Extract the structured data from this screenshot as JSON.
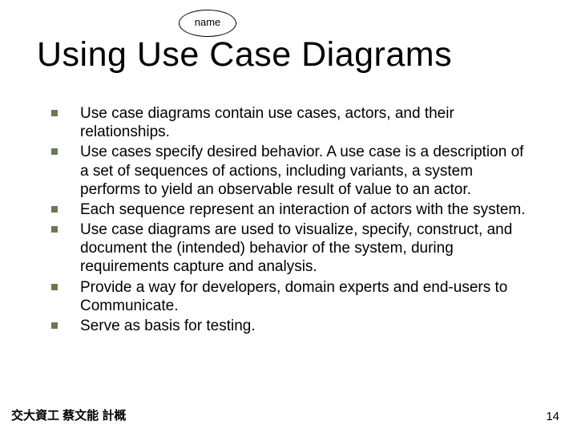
{
  "callout": {
    "label": "name"
  },
  "title": "Using Use Case Diagrams",
  "bullets": [
    "Use case diagrams contain use cases, actors, and their relationships.",
    "Use cases specify desired behavior. A use case is a description of a set of sequences of actions, including variants, a system performs to yield an observable result of value to an actor.",
    "Each sequence represent an interaction of actors with the system.",
    "Use case diagrams are used to visualize, specify, construct, and document the (intended) behavior of the system, during requirements capture and analysis.",
    "Provide a way for developers, domain experts and end-users to Communicate.",
    "Serve as basis for testing."
  ],
  "footer": {
    "left": "交大資工 蔡文能 計概",
    "page": "14"
  }
}
